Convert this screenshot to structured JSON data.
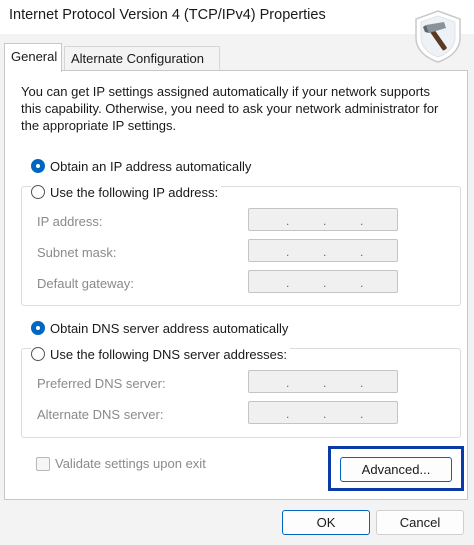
{
  "window": {
    "title": "Internet Protocol Version 4 (TCP/IPv4) Properties"
  },
  "tabs": [
    {
      "label": "General",
      "selected": true
    },
    {
      "label": "Alternate Configuration",
      "selected": false
    }
  ],
  "description": "You can get IP settings assigned automatically if your network supports this capability. Otherwise, you need to ask your network administrator for the appropriate IP settings.",
  "ip": {
    "auto_label": "Obtain an IP address automatically",
    "auto_selected": true,
    "manual_label": "Use the following IP address:",
    "manual_selected": false,
    "fields": [
      {
        "label": "IP address:",
        "value": ". . ."
      },
      {
        "label": "Subnet mask:",
        "value": ". . ."
      },
      {
        "label": "Default gateway:",
        "value": ". . ."
      }
    ]
  },
  "dns": {
    "auto_label": "Obtain DNS server address automatically",
    "auto_selected": true,
    "manual_label": "Use the following DNS server addresses:",
    "manual_selected": false,
    "fields": [
      {
        "label": "Preferred DNS server:",
        "value": ". . ."
      },
      {
        "label": "Alternate DNS server:",
        "value": ". . ."
      }
    ]
  },
  "validate": {
    "label": "Validate settings upon exit",
    "checked": false
  },
  "buttons": {
    "advanced": "Advanced...",
    "ok": "OK",
    "cancel": "Cancel"
  },
  "colors": {
    "accent": "#0067c0",
    "highlight_box": "#0a3aa8"
  },
  "icons": {
    "logo": "hammer-badge-logo"
  }
}
